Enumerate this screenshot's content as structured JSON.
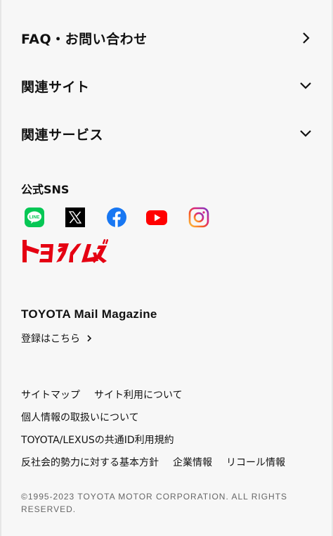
{
  "accordion": {
    "faq": "FAQ・お問い合わせ",
    "related_sites": "関連サイト",
    "related_services": "関連サービス"
  },
  "sns": {
    "title": "公式SNS",
    "icons": [
      "line-icon",
      "x-icon",
      "facebook-icon",
      "youtube-icon",
      "instagram-icon"
    ],
    "line_label": "LINE",
    "colors": {
      "line": "#06C755",
      "facebook": "#1877F2",
      "youtube": "#FF0000",
      "x": "#000000"
    }
  },
  "toyotimes": {
    "logo_text": "トヨタイムズ",
    "color": "#E50012"
  },
  "mail": {
    "title": "TOYOTA Mail Magazine",
    "link": "登録はこちら"
  },
  "footer_links": {
    "sitemap": "サイトマップ",
    "site_usage": "サイト利用について",
    "privacy": "個人情報の取扱いについて",
    "common_id": "TOYOTA/LEXUSの共通ID利用規約",
    "anti_social": "反社会的勢力に対する基本方針",
    "corporate": "企業情報",
    "recall": "リコール情報"
  },
  "copyright": "©1995-2023 TOYOTA MOTOR CORPORATION. ALL RIGHTS RESERVED."
}
